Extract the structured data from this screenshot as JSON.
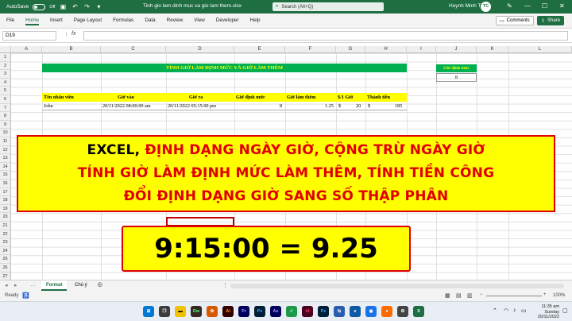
{
  "titlebar": {
    "autosave_label": "AutoSave",
    "autosave_state": "Off",
    "doc_title": "Tinh gio lam dinh muc va gio lam them.xlsx",
    "search_placeholder": "Search (Alt+Q)",
    "user_name": "Huynh Minh Trung",
    "avatar_initials": "TC"
  },
  "ribbon": {
    "tabs": [
      "File",
      "Home",
      "Insert",
      "Page Layout",
      "Formulas",
      "Data",
      "Review",
      "View",
      "Developer",
      "Help"
    ],
    "active_tab": "Home",
    "comments_label": "Comments",
    "share_label": "Share"
  },
  "formula_bar": {
    "name_box": "D19",
    "fx_label": "fx",
    "formula": ""
  },
  "columns": [
    "A",
    "B",
    "C",
    "D",
    "E",
    "F",
    "G",
    "H",
    "I",
    "J",
    "K",
    "L"
  ],
  "rows": [
    "1",
    "2",
    "3",
    "4",
    "5",
    "6",
    "7",
    "8",
    "9",
    "10",
    "11",
    "12",
    "13",
    "14",
    "15",
    "16",
    "17",
    "18",
    "19",
    "20",
    "21",
    "22",
    "23",
    "24",
    "25",
    "26",
    "27"
  ],
  "sheet": {
    "title": "TÍNH GIỜ LÀM ĐỊNH MỨC VÀ GIỜ LÀM THÊM",
    "standard_hours_label": "Giờ định mức",
    "standard_hours_value": "8",
    "headers": [
      "Tên nhân viên",
      "Giờ vào",
      "Giờ ra",
      "Giờ định mức",
      "Giờ làm thêm",
      "$/1 Giờ",
      "Thành tiền"
    ],
    "row": {
      "name": "John",
      "time_in": "20/11/2022 08:00:00 am",
      "time_out": "20/11/2022 05:15:00 pm",
      "standard_hours": "8",
      "overtime": "1.25",
      "rate_symbol": "$",
      "rate": "20",
      "amount_symbol": "$",
      "amount": "185"
    }
  },
  "banner": {
    "line1_dark": "EXCEL,",
    "line1_red": " ĐỊNH DẠNG NGÀY GIỜ, CỘNG TRỪ NGÀY GIỜ",
    "line2": "TÍNH GIỜ LÀM ĐỊNH MỨC LÀM THÊM, TÍNH TIỀN CÔNG",
    "line3": "ĐỔI ĐỊNH DẠNG GIỜ SANG SỐ THẬP PHÂN"
  },
  "formula_box": "9:15:00 = 9.25",
  "sheet_tabs": [
    "Format",
    "Chú ý"
  ],
  "status": {
    "ready": "Ready",
    "zoom": "100%"
  },
  "taskbar": {
    "apps": [
      "Dw",
      "Ai",
      "Pr",
      "Ps",
      "Ae",
      "Id",
      "Ps"
    ],
    "time": "11:35 am",
    "day": "Sunday",
    "date": "20/11/2022"
  },
  "colors": {
    "excel_green": "#1e6e42",
    "title_green": "#00b050",
    "highlight_yellow": "#ffff00",
    "banner_red": "#e00000"
  }
}
